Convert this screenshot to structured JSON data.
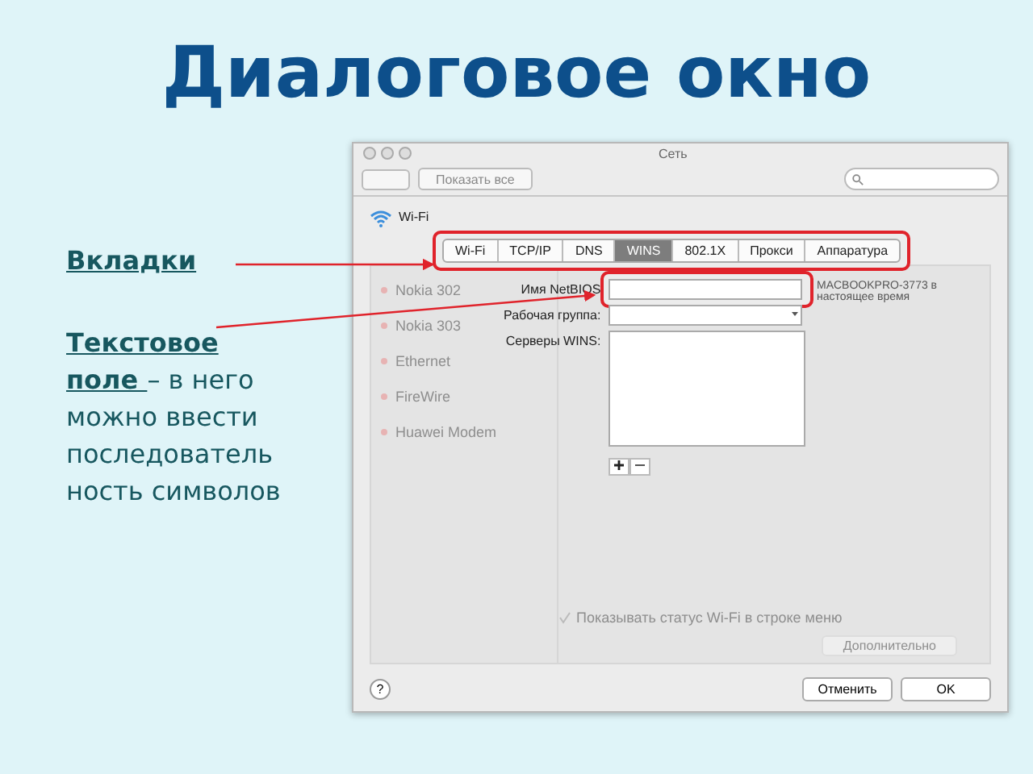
{
  "slide": {
    "title": "Диалоговое окно",
    "callouts": [
      {
        "term": "Вкладки"
      },
      {
        "term": "Текстовое поле ",
        "rest": "– в него можно ввести последовательность символов"
      }
    ]
  },
  "window": {
    "title": "Сеть",
    "show_all": "Показать все"
  },
  "sidebar": [
    {
      "name": "Nokia 302"
    },
    {
      "name": "Nokia 303"
    },
    {
      "name": "Ethernet"
    },
    {
      "name": "FireWire"
    },
    {
      "name": "Huawei Modem"
    }
  ],
  "service": {
    "name": "Wi-Fi"
  },
  "tabs": [
    {
      "label": "Wi-Fi",
      "selected": false
    },
    {
      "label": "TCP/IP",
      "selected": false
    },
    {
      "label": "DNS",
      "selected": false
    },
    {
      "label": "WINS",
      "selected": true
    },
    {
      "label": "802.1X",
      "selected": false
    },
    {
      "label": "Прокси",
      "selected": false
    },
    {
      "label": "Аппаратура",
      "selected": false
    }
  ],
  "fields": [
    {
      "kind": "text",
      "label": "Имя NetBIOS"
    },
    {
      "kind": "select",
      "label": "Рабочая группа:"
    },
    {
      "kind": "list",
      "label": "Серверы WINS:"
    }
  ],
  "note": "MACBOOKPRO-3773 в настоящее время",
  "status_checkbox": {
    "label": "Показывать статус Wi-Fi в строке меню",
    "checked": true
  },
  "advanced": "Дополнительно",
  "help": "?",
  "buttons": [
    "Отменить",
    "OK"
  ]
}
